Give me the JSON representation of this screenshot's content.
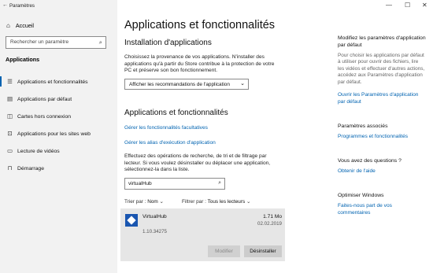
{
  "window": {
    "title": "Paramètres",
    "controls": [
      "—",
      "☐",
      "✕"
    ]
  },
  "sidebar": {
    "home_label": "Accueil",
    "search_placeholder": "Rechercher un paramètre",
    "section_label": "Applications",
    "items": [
      {
        "label": "Applications et fonctionnalités",
        "icon": "list-icon",
        "glyph": "☰"
      },
      {
        "label": "Applications par défaut",
        "icon": "default-apps-icon",
        "glyph": "▤"
      },
      {
        "label": "Cartes hors connexion",
        "icon": "map-icon",
        "glyph": "◫"
      },
      {
        "label": "Applications pour les sites web",
        "icon": "web-apps-icon",
        "glyph": "⊡"
      },
      {
        "label": "Lecture de vidéos",
        "icon": "video-icon",
        "glyph": "▭"
      },
      {
        "label": "Démarrage",
        "icon": "startup-icon",
        "glyph": "⊓"
      }
    ]
  },
  "main": {
    "title": "Applications et fonctionnalités",
    "install_heading": "Installation d'applications",
    "install_text": "Choisissez la provenance de vos applications. N'installer des applications qu'à partir du Store contribue à la protection de votre PC et préserve son bon fonctionnement.",
    "install_dropdown": "Afficher les recommandations de l'application",
    "apps_heading": "Applications et fonctionnalités",
    "link_optional": "Gérer les fonctionnalités facultatives",
    "link_alias": "Gérer les alias d'exécution d'application",
    "apps_text": "Effectuez des opérations de recherche, de tri et de filtrage par lecteur. Si vous voulez désinstaller ou déplacer une application, sélectionnez-la dans la liste.",
    "filter_value": "virtualHub",
    "sort_label": "Trier par :",
    "sort_value": "Nom",
    "filter_label": "Filtrer par :",
    "filter_drive": "Tous les lecteurs",
    "app": {
      "name": "VirtualHub",
      "version": "1.10.34275",
      "size": "1.71 Mo",
      "date": "02.02.2019",
      "modify_label": "Modifier",
      "uninstall_label": "Désinstaller"
    }
  },
  "right": {
    "heading1": "Modifiez les paramètres d'application par défaut",
    "text1": "Pour choisir les applications par défaut à utiliser pour ouvrir des fichiers, lire les vidéos et effectuer d'autres actions, accédez aux Paramètres d'application par défaut.",
    "link1": "Ouvrir les Paramètres d'application par défaut",
    "heading2": "Paramètres associés",
    "link2": "Programmes et fonctionnalités",
    "heading3": "Vous avez des questions ?",
    "link3": "Obtenir de l'aide",
    "heading4": "Optimiser Windows",
    "link4": "Faites-nous part de vos commentaires"
  },
  "colors": {
    "accent": "#0063b1",
    "sidebar_bg": "#f2f2f2",
    "app_icon": "#1a56b0"
  }
}
